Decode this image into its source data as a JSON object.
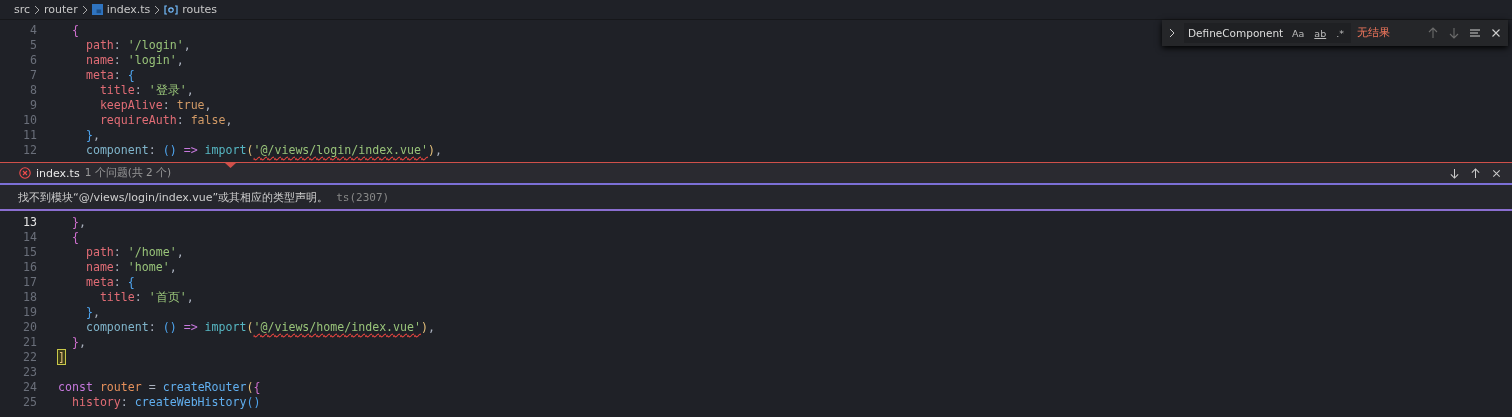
{
  "breadcrumb": [
    {
      "label": "src",
      "kind": "folder"
    },
    {
      "label": "router",
      "kind": "folder"
    },
    {
      "label": "index.ts",
      "kind": "file"
    },
    {
      "label": "routes",
      "kind": "symbol"
    }
  ],
  "find_widget": {
    "expanded": false,
    "value": "DefineComponent",
    "options": [
      {
        "label": "Aa",
        "selected": false
      },
      {
        "label": "ab",
        "selected": false
      },
      {
        "label": ".*",
        "selected": false
      }
    ],
    "result": "无结果",
    "nav": [
      {
        "kind": "up",
        "disabled": true
      },
      {
        "kind": "down",
        "disabled": true
      },
      {
        "kind": "selection",
        "disabled": false
      },
      {
        "kind": "close",
        "disabled": false
      }
    ]
  },
  "code_top": [
    {
      "number": "4",
      "tokens": [
        {
          "t": "  {",
          "kind": "b1"
        }
      ]
    },
    {
      "number": "5",
      "tokens": [
        {
          "t": "    path",
          "kind": "key"
        },
        {
          "t": ": ",
          "kind": "p"
        },
        {
          "t": "'/login'",
          "kind": "str"
        },
        {
          "t": ",",
          "kind": "p"
        }
      ]
    },
    {
      "number": "6",
      "tokens": [
        {
          "t": "    name",
          "kind": "key"
        },
        {
          "t": ": ",
          "kind": "p"
        },
        {
          "t": "'login'",
          "kind": "str"
        },
        {
          "t": ",",
          "kind": "p"
        }
      ]
    },
    {
      "number": "7",
      "tokens": [
        {
          "t": "    meta",
          "kind": "key"
        },
        {
          "t": ": ",
          "kind": "p"
        },
        {
          "t": "{",
          "kind": "b2"
        }
      ]
    },
    {
      "number": "8",
      "tokens": [
        {
          "t": "      title",
          "kind": "key"
        },
        {
          "t": ": ",
          "kind": "p"
        },
        {
          "t": "'登录'",
          "kind": "str"
        },
        {
          "t": ",",
          "kind": "p"
        }
      ]
    },
    {
      "number": "9",
      "tokens": [
        {
          "t": "      keepAlive",
          "kind": "key"
        },
        {
          "t": ": ",
          "kind": "p"
        },
        {
          "t": "true",
          "kind": "bool"
        },
        {
          "t": ",",
          "kind": "p"
        }
      ]
    },
    {
      "number": "10",
      "tokens": [
        {
          "t": "      requireAuth",
          "kind": "key"
        },
        {
          "t": ": ",
          "kind": "p"
        },
        {
          "t": "false",
          "kind": "bool"
        },
        {
          "t": ",",
          "kind": "p"
        }
      ]
    },
    {
      "number": "11",
      "tokens": [
        {
          "t": "    }",
          "kind": "b2"
        },
        {
          "t": ",",
          "kind": "p"
        }
      ]
    },
    {
      "number": "12",
      "tokens": [
        {
          "t": "    component",
          "kind": "prop"
        },
        {
          "t": ": ",
          "kind": "p"
        },
        {
          "t": "()",
          "kind": "b2"
        },
        {
          "t": " =>",
          "kind": "kw"
        },
        {
          "t": " import",
          "kind": "builtin"
        },
        {
          "t": "(",
          "kind": "b3"
        },
        {
          "t": "'@/views/login/index.vue'",
          "kind": "str",
          "error": true
        },
        {
          "t": ")",
          "kind": "b3"
        },
        {
          "t": ",",
          "kind": "p"
        }
      ]
    }
  ],
  "problem_peek": {
    "file": "index.ts",
    "summary": "1 个问题(共 2 个)",
    "message": "找不到模块“@/views/login/index.vue”或其相应的类型声明。",
    "code": "ts(2307)",
    "kind": "error"
  },
  "code_bottom": [
    {
      "number": "13",
      "current": true,
      "tokens": [
        {
          "t": "  }",
          "kind": "b1"
        },
        {
          "t": ",",
          "kind": "p"
        }
      ]
    },
    {
      "number": "14",
      "tokens": [
        {
          "t": "  {",
          "kind": "b1"
        }
      ]
    },
    {
      "number": "15",
      "tokens": [
        {
          "t": "    path",
          "kind": "key"
        },
        {
          "t": ": ",
          "kind": "p"
        },
        {
          "t": "'/home'",
          "kind": "str"
        },
        {
          "t": ",",
          "kind": "p"
        }
      ]
    },
    {
      "number": "16",
      "tokens": [
        {
          "t": "    name",
          "kind": "key"
        },
        {
          "t": ": ",
          "kind": "p"
        },
        {
          "t": "'home'",
          "kind": "str"
        },
        {
          "t": ",",
          "kind": "p"
        }
      ]
    },
    {
      "number": "17",
      "tokens": [
        {
          "t": "    meta",
          "kind": "key"
        },
        {
          "t": ": ",
          "kind": "p"
        },
        {
          "t": "{",
          "kind": "b2"
        }
      ]
    },
    {
      "number": "18",
      "tokens": [
        {
          "t": "      title",
          "kind": "key"
        },
        {
          "t": ": ",
          "kind": "p"
        },
        {
          "t": "'首页'",
          "kind": "str"
        },
        {
          "t": ",",
          "kind": "p"
        }
      ]
    },
    {
      "number": "19",
      "tokens": [
        {
          "t": "    }",
          "kind": "b2"
        },
        {
          "t": ",",
          "kind": "p"
        }
      ]
    },
    {
      "number": "20",
      "tokens": [
        {
          "t": "    component",
          "kind": "prop"
        },
        {
          "t": ": ",
          "kind": "p"
        },
        {
          "t": "()",
          "kind": "b2"
        },
        {
          "t": " =>",
          "kind": "kw"
        },
        {
          "t": " import",
          "kind": "builtin"
        },
        {
          "t": "(",
          "kind": "b3"
        },
        {
          "t": "'@/views/home/index.vue'",
          "kind": "str",
          "error": true
        },
        {
          "t": ")",
          "kind": "b3"
        },
        {
          "t": ",",
          "kind": "p"
        }
      ]
    },
    {
      "number": "21",
      "tokens": [
        {
          "t": "  }",
          "kind": "b1"
        },
        {
          "t": ",",
          "kind": "p"
        }
      ]
    },
    {
      "number": "22",
      "tokens": [
        {
          "t": "]",
          "kind": "b3",
          "matched": true
        }
      ]
    },
    {
      "number": "23"
    },
    {
      "number": "24",
      "tokens": [
        {
          "t": "const",
          "kind": "kw"
        },
        {
          "t": " router",
          "kind": "var"
        },
        {
          "t": " = ",
          "kind": "p"
        },
        {
          "t": "createRouter",
          "kind": "fn"
        },
        {
          "t": "(",
          "kind": "b3"
        },
        {
          "t": "{",
          "kind": "b1"
        }
      ]
    },
    {
      "number": "25",
      "tokens": [
        {
          "t": "  history",
          "kind": "key"
        },
        {
          "t": ": ",
          "kind": "p"
        },
        {
          "t": "createWebHistory",
          "kind": "fn"
        },
        {
          "t": "()",
          "kind": "b2"
        }
      ]
    }
  ]
}
